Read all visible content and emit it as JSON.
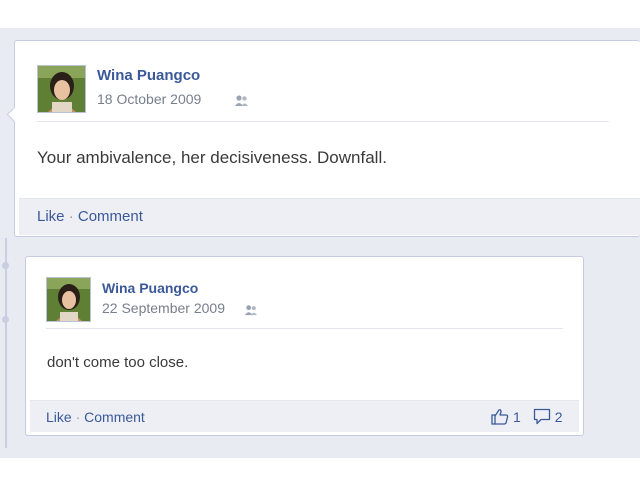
{
  "posts": [
    {
      "author": "Wina Puangco",
      "date": "18 October 2009",
      "privacy_icon": "friends-icon",
      "text": "Your ambivalence, her decisiveness. Downfall.",
      "actions": {
        "like": "Like",
        "separator": "·",
        "comment": "Comment"
      }
    },
    {
      "author": "Wina Puangco",
      "date": "22 September 2009",
      "privacy_icon": "friends-icon",
      "text": "don't come too close.",
      "actions": {
        "like": "Like",
        "separator": "·",
        "comment": "Comment"
      },
      "stats": {
        "likes": "1",
        "comments": "2"
      }
    }
  ],
  "colors": {
    "link": "#3b5998",
    "timeline_bg": "#e9ebf2",
    "footer_bg": "#edeff4"
  }
}
